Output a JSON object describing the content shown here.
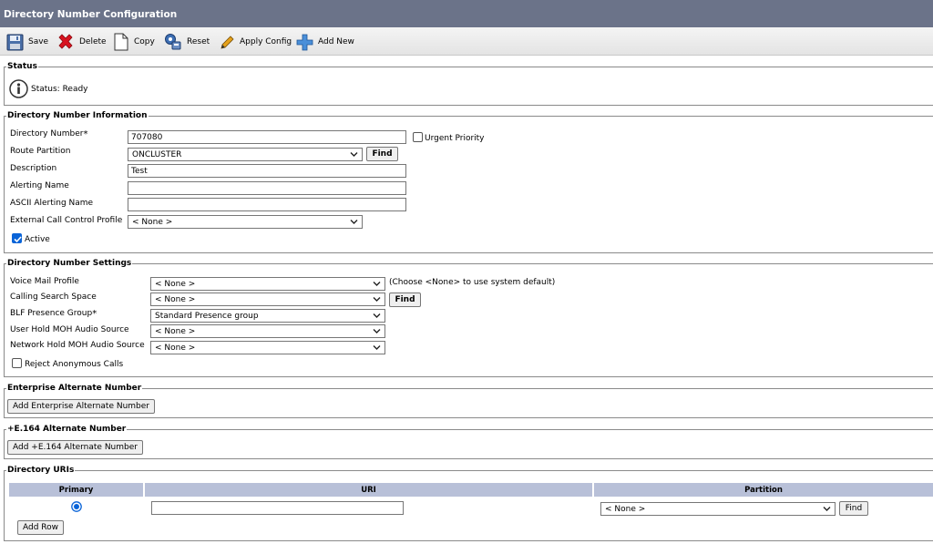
{
  "title": "Directory Number Configuration",
  "toolbar": {
    "save": "Save",
    "delete": "Delete",
    "copy": "Copy",
    "reset": "Reset",
    "apply_config": "Apply Config",
    "add_new": "Add New"
  },
  "status": {
    "legend": "Status",
    "text": "Status: Ready"
  },
  "dn_info": {
    "legend": "Directory Number Information",
    "directory_number_label": "Directory Number",
    "required_mark": "*",
    "directory_number_value": "707080",
    "urgent_priority_label": "Urgent Priority",
    "urgent_priority_checked": false,
    "route_partition_label": "Route Partition",
    "route_partition_value": "ONCLUSTER",
    "find_label": "Find",
    "description_label": "Description",
    "description_value": "Test",
    "alerting_name_label": "Alerting Name",
    "alerting_name_value": "",
    "ascii_alerting_name_label": "ASCII Alerting Name",
    "ascii_alerting_name_value": "",
    "external_call_control_label": "External Call Control Profile",
    "external_call_control_value": "< None >",
    "active_label": "Active",
    "active_checked": true
  },
  "dn_settings": {
    "legend": "Directory Number Settings",
    "voice_mail_profile_label": "Voice Mail Profile",
    "voice_mail_profile_value": "< None >",
    "voice_mail_hint": "(Choose <None> to use system default)",
    "calling_search_space_label": "Calling Search Space",
    "calling_search_space_value": "< None >",
    "find_label": "Find",
    "blf_presence_group_label": "BLF Presence Group",
    "required_mark": "*",
    "blf_presence_group_value": "Standard Presence group",
    "user_hold_moh_label": "User Hold MOH Audio Source",
    "user_hold_moh_value": "< None >",
    "network_hold_moh_label": "Network Hold MOH Audio Source",
    "network_hold_moh_value": "< None >",
    "reject_anonymous_label": "Reject Anonymous Calls",
    "reject_anonymous_checked": false
  },
  "enterprise_alt": {
    "legend": "Enterprise Alternate Number",
    "button": "Add Enterprise Alternate Number"
  },
  "e164_alt": {
    "legend": "+E.164 Alternate Number",
    "button": "Add +E.164 Alternate Number"
  },
  "directory_uris": {
    "legend": "Directory URIs",
    "columns": [
      "Primary",
      "URI",
      "Partition"
    ],
    "row": {
      "primary_selected": true,
      "uri_value": "",
      "partition_value": "< None >",
      "find_label": "Find"
    },
    "add_row": "Add Row"
  },
  "colors": {
    "title_bar": "#6b7389",
    "table_header": "#b8c0d8",
    "checkbox_checked": "#0a64d8",
    "delete_icon": "#d8121f",
    "add_icon": "#4a8fd9"
  },
  "icons": [
    "save-icon",
    "delete-icon",
    "copy-icon",
    "reset-icon",
    "apply-config-icon",
    "add-new-icon",
    "info-icon",
    "chevron-down-icon"
  ]
}
